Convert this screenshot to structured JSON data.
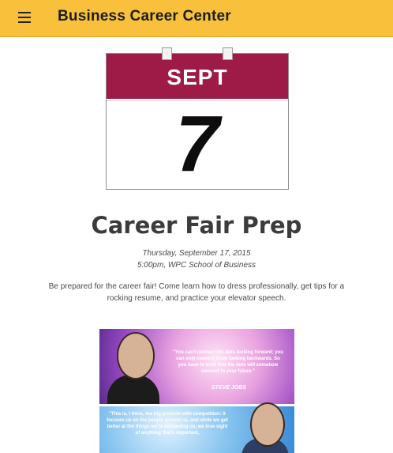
{
  "header": {
    "menu_icon": "hamburger-menu-icon",
    "title": "Business Career Center",
    "color": "#f9c13b"
  },
  "calendar": {
    "month": "SEPT",
    "day": "7",
    "accent": "#9e1a47"
  },
  "event": {
    "title": "Career Fair Prep",
    "date": "Thursday, September 17, 2015",
    "time": "5:00pm, WPC School of Business",
    "description": "Be prepared for the career fair! Come learn how to dress professionally, get tips for a rocking resume, and practice your elevator speech."
  },
  "quote_image": {
    "top_quote": "\"You can't connect the dots looking forward; you can only connect them looking backwards. So you have to trust that the dots will somehow connect in your future.\"",
    "top_author": "STEVE JOBS",
    "bottom_quote": "\"This is, I think, the big problem with competition: It focuses us on the people around us, and while we get better at the things we're competing on, we lose sight of anything that's important,"
  }
}
